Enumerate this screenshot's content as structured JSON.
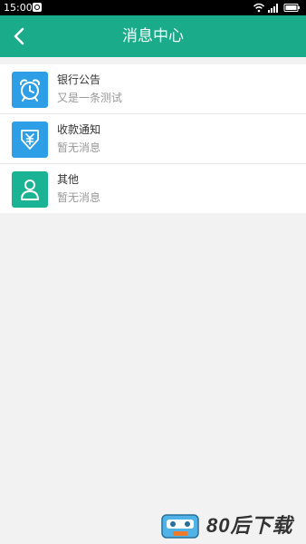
{
  "status_bar": {
    "time": "15:00"
  },
  "header": {
    "title": "消息中心"
  },
  "messages": [
    {
      "title": "银行公告",
      "subtitle": "又是一条测试",
      "icon": "alarm-clock-icon",
      "color": "#2e9fe6"
    },
    {
      "title": "收款通知",
      "subtitle": "暂无消息",
      "icon": "yen-download-icon",
      "color": "#2e9fe6"
    },
    {
      "title": "其他",
      "subtitle": "暂无消息",
      "icon": "person-icon",
      "color": "#1ab394"
    }
  ],
  "watermark": {
    "text": "80后下载"
  },
  "colors": {
    "primary": "#1aab8b",
    "background": "#f2f2f2"
  }
}
